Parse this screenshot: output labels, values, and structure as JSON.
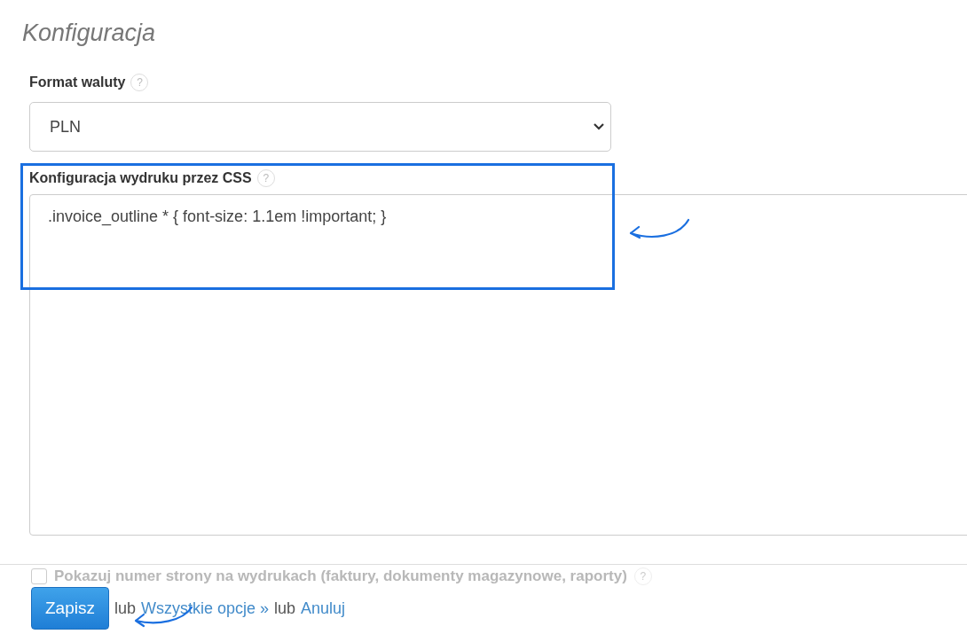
{
  "title": "Konfiguracja",
  "fields": [
    {
      "kind": "select",
      "label": "Format waluty",
      "help": "?",
      "value": "PLN"
    },
    {
      "kind": "textarea",
      "label": "Konfiguracja wydruku przez CSS",
      "help": "?",
      "value": ".invoice_outline * { font-size: 1.1em !important; }"
    }
  ],
  "checkbox": {
    "label": "Pokazuj numer strony na wydrukach (faktury, dokumenty magazynowe, raporty)",
    "help": "?",
    "checked": false
  },
  "footer": {
    "save": "Zapisz",
    "sep_1": "lub",
    "link_1": "Wszystkie opcje »",
    "sep_2": "lub",
    "link_2": "Anuluj"
  }
}
